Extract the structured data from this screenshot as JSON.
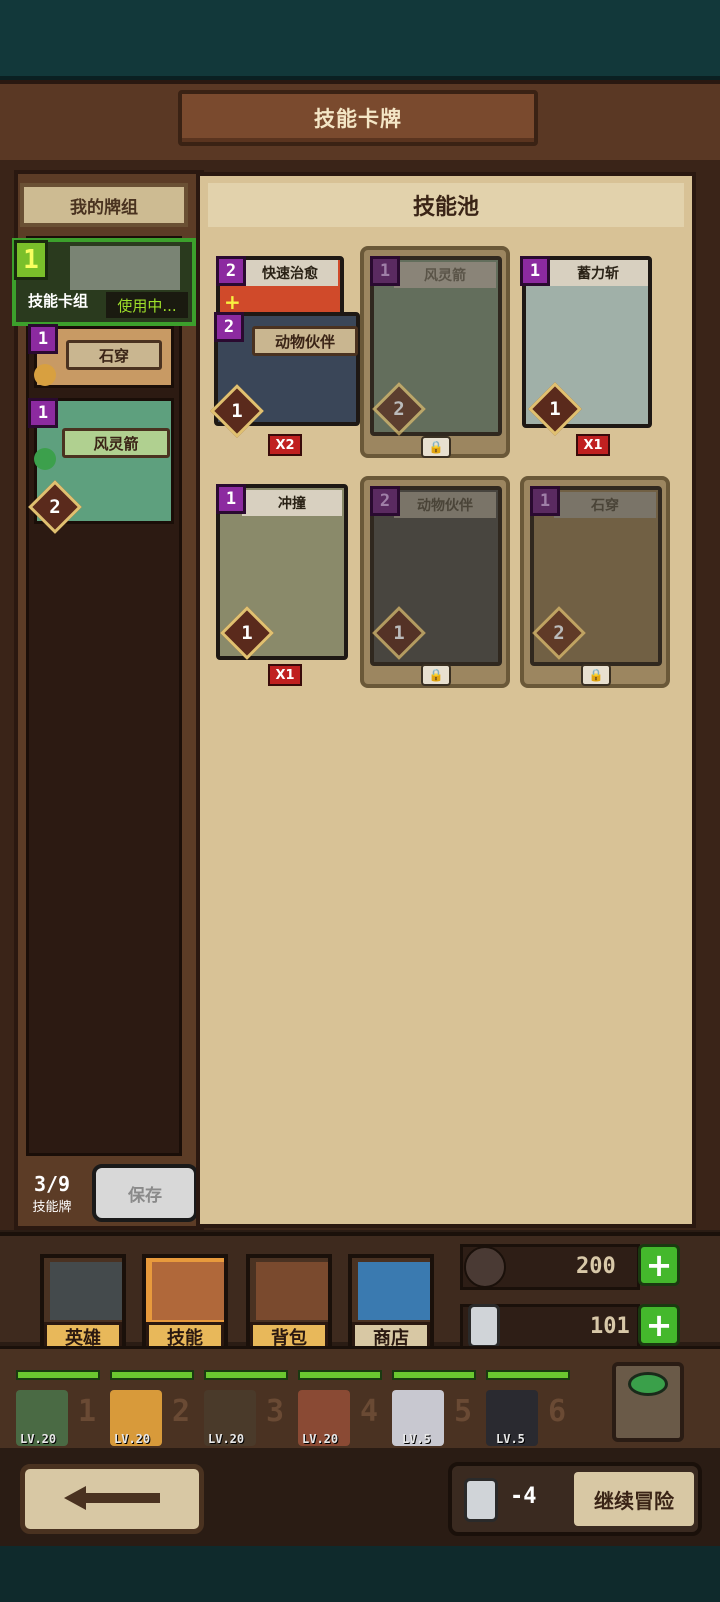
{
  "header": {
    "title": "技能卡牌"
  },
  "left": {
    "my_deck_label": "我的牌组",
    "deck": {
      "number": "1",
      "name": "技能卡组",
      "status": "使用中..."
    },
    "slots": [
      {
        "cost": "1",
        "name": "石穿"
      },
      {
        "cost": "1",
        "name": "风灵箭",
        "level": "2"
      }
    ],
    "counter": {
      "value": "3/9",
      "label": "技能牌"
    },
    "save_label": "保存"
  },
  "pool": {
    "title": "技能池",
    "cards": [
      {
        "name": "快速治愈",
        "cost": "2"
      },
      {
        "name": "动物伙伴",
        "cost": "2",
        "level": "1",
        "count": "X2"
      },
      {
        "name": "风灵箭",
        "cost": "1",
        "level": "2",
        "locked": true
      },
      {
        "name": "蓄力斩",
        "cost": "1",
        "level": "1",
        "count": "X1"
      },
      {
        "name": "冲撞",
        "cost": "1",
        "level": "1",
        "count": "X1"
      },
      {
        "name": "动物伙伴",
        "cost": "2",
        "level": "1",
        "locked": true
      },
      {
        "name": "石穿",
        "cost": "1",
        "level": "2",
        "locked": true
      }
    ]
  },
  "tabs": [
    {
      "label": "英雄",
      "icon": "helmet-icon"
    },
    {
      "label": "技能",
      "icon": "skill-book-icon",
      "active": true
    },
    {
      "label": "背包",
      "icon": "backpack-icon"
    },
    {
      "label": "商店",
      "icon": "shop-icon"
    }
  ],
  "resources": [
    {
      "icon": "feather-icon",
      "value": "200"
    },
    {
      "icon": "potion-bottle-icon",
      "value": "101"
    }
  ],
  "heroes": [
    {
      "slot": "1",
      "level": "LV.20"
    },
    {
      "slot": "2",
      "level": "LV.20"
    },
    {
      "slot": "3",
      "level": "LV.20"
    },
    {
      "slot": "4",
      "level": "LV.20"
    },
    {
      "slot": "5",
      "level": "LV.5"
    },
    {
      "slot": "6",
      "level": "LV.5"
    }
  ],
  "continue": {
    "cost": "-4",
    "label": "继续冒险"
  },
  "colors": {
    "accent_green": "#44b82c",
    "card_cost": "#8c2aa0",
    "count_red": "#c02020"
  }
}
